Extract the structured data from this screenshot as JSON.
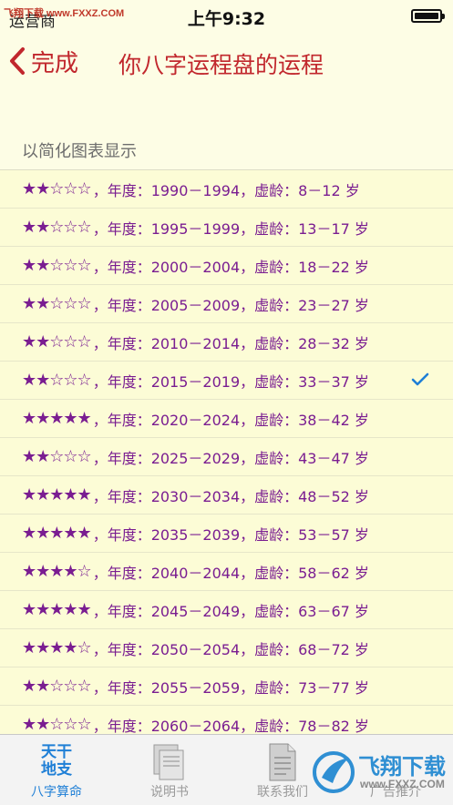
{
  "status_bar": {
    "watermark": "飞翔下载 www.FXXZ.COM",
    "carrier": "运营商",
    "time": "上午9:32"
  },
  "nav": {
    "back_label": "完成",
    "title": "你八字运程盘的运程"
  },
  "section_label": "以简化图表显示",
  "rows": [
    {
      "stars": "★★☆☆☆",
      "text": "，年度：1990－1994，虚龄：8－12 岁",
      "rating": 2,
      "selected": false
    },
    {
      "stars": "★★☆☆☆",
      "text": "，年度：1995－1999，虚龄：13－17 岁",
      "rating": 2,
      "selected": false
    },
    {
      "stars": "★★☆☆☆",
      "text": "，年度：2000－2004，虚龄：18－22 岁",
      "rating": 2,
      "selected": false
    },
    {
      "stars": "★★☆☆☆",
      "text": "，年度：2005－2009，虚龄：23－27 岁",
      "rating": 2,
      "selected": false
    },
    {
      "stars": "★★☆☆☆",
      "text": "，年度：2010－2014，虚龄：28－32 岁",
      "rating": 2,
      "selected": false
    },
    {
      "stars": "★★☆☆☆",
      "text": "，年度：2015－2019，虚龄：33－37 岁",
      "rating": 2,
      "selected": true
    },
    {
      "stars": "★★★★★",
      "text": "，年度：2020－2024，虚龄：38－42 岁",
      "rating": 5,
      "selected": false
    },
    {
      "stars": "★★☆☆☆",
      "text": "，年度：2025－2029，虚龄：43－47 岁",
      "rating": 2,
      "selected": false
    },
    {
      "stars": "★★★★★",
      "text": "，年度：2030－2034，虚龄：48－52 岁",
      "rating": 5,
      "selected": false
    },
    {
      "stars": "★★★★★",
      "text": "，年度：2035－2039，虚龄：53－57 岁",
      "rating": 5,
      "selected": false
    },
    {
      "stars": "★★★★☆",
      "text": "，年度：2040－2044，虚龄：58－62 岁",
      "rating": 4,
      "selected": false
    },
    {
      "stars": "★★★★★",
      "text": "，年度：2045－2049，虚龄：63－67 岁",
      "rating": 5,
      "selected": false
    },
    {
      "stars": "★★★★☆",
      "text": "，年度：2050－2054，虚龄：68－72 岁",
      "rating": 4,
      "selected": false
    },
    {
      "stars": "★★☆☆☆",
      "text": "，年度：2055－2059，虚龄：73－77 岁",
      "rating": 2,
      "selected": false
    },
    {
      "stars": "★★☆☆☆",
      "text": "，年度：2060－2064，虚龄：78－82 岁",
      "rating": 2,
      "selected": false
    }
  ],
  "tabs": [
    {
      "label": "八字算命",
      "icon_text_1": "天干",
      "icon_text_2": "地支",
      "icon": "bazi-icon",
      "active": true
    },
    {
      "label": "说明书",
      "icon": "manual-icon",
      "active": false
    },
    {
      "label": "联系我们",
      "icon": "document-icon",
      "active": false
    },
    {
      "label": "广告推介",
      "icon": "ad-icon",
      "active": false
    }
  ],
  "watermark_logo": {
    "title": "飞翔下载",
    "url": "www.FXXZ.COM"
  },
  "colors": {
    "accent_red": "#c1272d",
    "row_text_purple": "#7a1d91",
    "background_cream": "#fdfde5",
    "tab_active_blue": "#1f7fd6"
  }
}
